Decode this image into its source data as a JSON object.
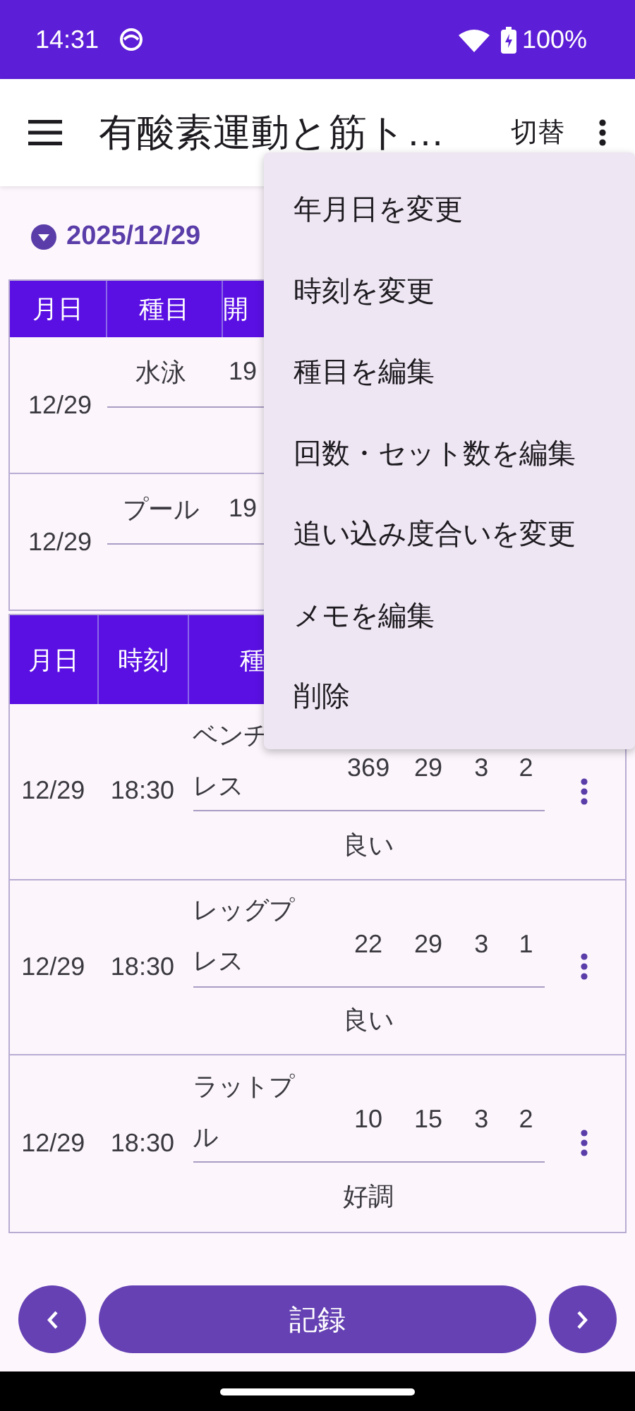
{
  "status_bar": {
    "time": "14:31",
    "battery": "100%"
  },
  "app_bar": {
    "title": "有酸素運動と筋ト…",
    "switch_label": "切替"
  },
  "date_selector": {
    "date": "2025/12/29"
  },
  "cardio_table": {
    "columns": [
      "月日",
      "種目",
      "開"
    ],
    "rows": [
      {
        "date": "12/29",
        "exercise": "水泳",
        "column_3": "19"
      },
      {
        "date": "12/29",
        "exercise": "プール",
        "column_3": "19"
      }
    ]
  },
  "strength_table": {
    "columns": [
      "月日",
      "時刻",
      "種"
    ],
    "rows": [
      {
        "date": "12/29",
        "time": "18:30",
        "exercise_lines": [
          "ベンチ",
          "レス"
        ],
        "column_4": "369",
        "column_5": "29",
        "column_6": "3",
        "column_7": "2",
        "memo": "良い"
      },
      {
        "date": "12/29",
        "time": "18:30",
        "exercise_lines": [
          "レッグプ",
          "レス"
        ],
        "column_4": "22",
        "column_5": "29",
        "column_6": "3",
        "column_7": "1",
        "memo": "良い"
      },
      {
        "date": "12/29",
        "time": "18:30",
        "exercise_lines": [
          "ラットプ",
          "ル"
        ],
        "column_4": "10",
        "column_5": "15",
        "column_6": "3",
        "column_7": "2",
        "memo": "好調"
      }
    ]
  },
  "menu": {
    "items": [
      "年月日を変更",
      "時刻を変更",
      "種目を編集",
      "回数・セット数を編集",
      "追い込み度合いを変更",
      "メモを編集",
      "削除"
    ]
  },
  "bottom_bar": {
    "record_label": "記録"
  }
}
